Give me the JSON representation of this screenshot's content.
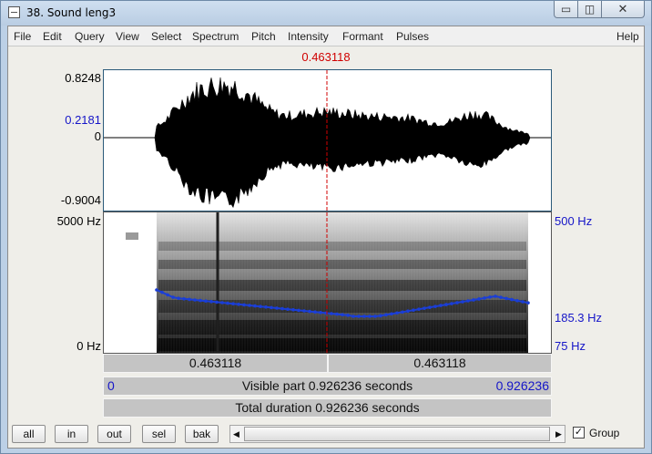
{
  "window": {
    "title": "38. Sound leng3",
    "min_glyph": "▭",
    "max_glyph": "◫",
    "close_glyph": "✕"
  },
  "menu": [
    "File",
    "Edit",
    "Query",
    "View",
    "Select",
    "Spectrum",
    "Pitch",
    "Intensity",
    "Formant",
    "Pulses"
  ],
  "help": "Help",
  "cursor_time": "0.463118",
  "waveform": {
    "top": "0.8248",
    "cursor_value": "0.2181",
    "zero": "0",
    "bottom": "-0.9004"
  },
  "spectrogram": {
    "top_freq": "5000 Hz",
    "bottom_freq": "0 Hz",
    "pitch_top": "500 Hz",
    "pitch_cursor": "185.3 Hz",
    "pitch_bottom": "75 Hz"
  },
  "bars": {
    "left_segment": "0.463118",
    "right_segment": "0.463118",
    "visible_start": "0",
    "visible_label": "Visible part 0.926236 seconds",
    "visible_end": "0.926236",
    "total_label": "Total duration 0.926236 seconds"
  },
  "buttons": [
    "all",
    "in",
    "out",
    "sel",
    "bak"
  ],
  "scroll": {
    "left_arrow": "◀",
    "right_arrow": "▶"
  },
  "group": {
    "label": "Group",
    "checked": "✓"
  },
  "colors": {
    "cursor": "#d00000",
    "pitch": "#1a3ed8",
    "axis_blue": "#1515c8"
  }
}
